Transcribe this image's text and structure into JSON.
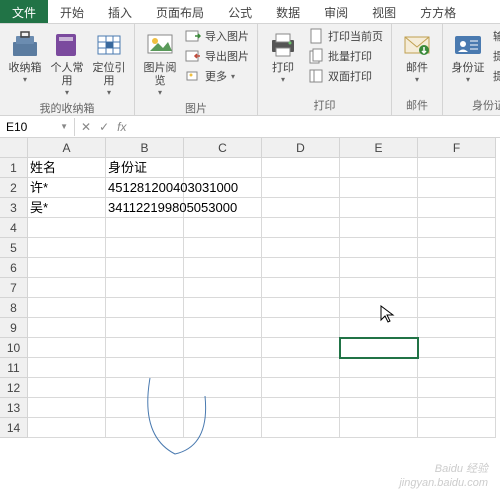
{
  "tabs": {
    "file": "文件",
    "home": "开始",
    "insert": "插入",
    "layout": "页面布局",
    "formula": "公式",
    "data": "数据",
    "review": "审阅",
    "view": "视图",
    "extra": "方方格"
  },
  "ribbon": {
    "group1": {
      "favorites": "收纳箱",
      "personal": "个人常用",
      "locate": "定位引用",
      "label": "我的收纳箱"
    },
    "group2": {
      "picview": "图片阅览",
      "import": "导入图片",
      "export": "导出图片",
      "more": "更多",
      "label": "图片"
    },
    "group3": {
      "print": "打印",
      "current": "打印当前页",
      "batch": "批量打印",
      "duplex": "双面打印",
      "label": "打印"
    },
    "group4": {
      "mail": "邮件",
      "label": "邮件"
    },
    "group5": {
      "idcard": "身份证",
      "inputid": "输入身",
      "extract1": "提取性",
      "extract2": "提取出",
      "label": "身份证"
    }
  },
  "namebox": "E10",
  "columns": [
    "A",
    "B",
    "C",
    "D",
    "E",
    "F"
  ],
  "rowcount": 14,
  "cells": {
    "A1": "姓名",
    "B1": "身份证",
    "A2": "许*",
    "B2": "451281200403031000",
    "A3": "吴*",
    "B3": "341122199805053000"
  },
  "watermark": {
    "l1": "Baidu 经验",
    "l2": "jingyan.baidu.com"
  }
}
